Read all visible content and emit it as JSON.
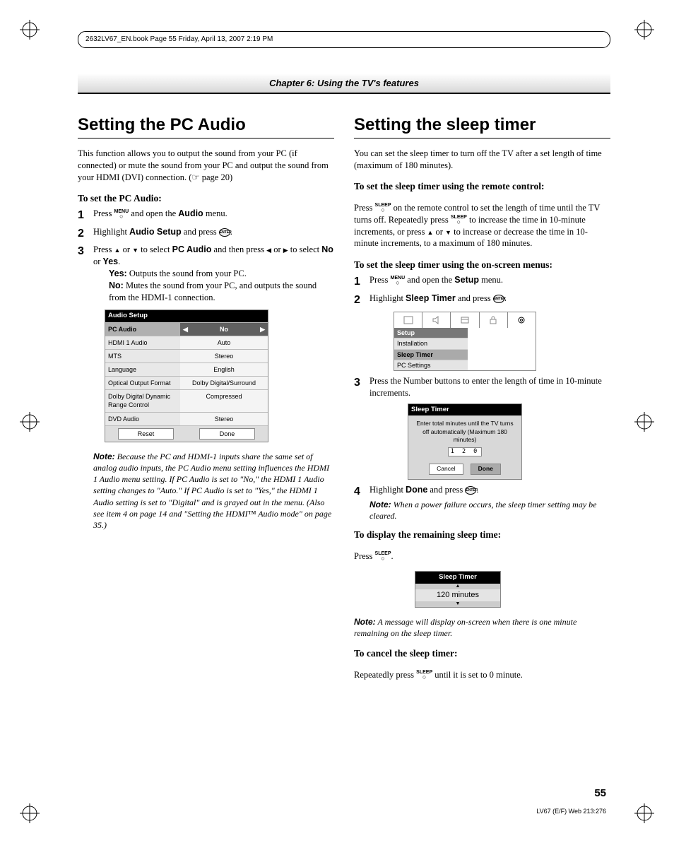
{
  "doc_info": "2632LV67_EN.book  Page 55  Friday, April 13, 2007  2:19 PM",
  "chapter_header": "Chapter 6: Using the TV's features",
  "page_number": "55",
  "footer_code": "LV67 (E/F) Web 213:276",
  "left": {
    "title": "Setting the PC Audio",
    "intro": "This function allows you to output the sound from your PC (if connected) or mute the sound from your PC and output the sound from your HDMI (DVI) connection. (☞ page 20)",
    "subhead": "To set the PC Audio:",
    "steps": {
      "s1_a": "Press ",
      "s1_b": " and open the ",
      "s1_menu": "Audio",
      "s1_c": " menu.",
      "s2_a": "Highlight ",
      "s2_b": "Audio Setup",
      "s2_c": " and press ",
      "s3_a": "Press ",
      "s3_b": " or ",
      "s3_c": " to select ",
      "s3_d": "PC Audio",
      "s3_e": " and then press ",
      "s3_f": " or ",
      "s3_g": " to select ",
      "s3_no": "No",
      "s3_or": " or ",
      "s3_yes": "Yes",
      "s3_end": ".",
      "yes_label": "Yes:",
      "yes_text": " Outputs the sound from your PC.",
      "no_label": "No:",
      "no_text": " Mutes the sound from your PC, and outputs the sound from the HDMI-1 connection."
    },
    "osd": {
      "title": "Audio Setup",
      "rows": [
        {
          "label": "PC Audio",
          "value": "No",
          "hl": true
        },
        {
          "label": "HDMI 1 Audio",
          "value": "Auto"
        },
        {
          "label": "MTS",
          "value": "Stereo"
        },
        {
          "label": "Language",
          "value": "English"
        },
        {
          "label": "Optical Output Format",
          "value": "Dolby Digital/Surround"
        },
        {
          "label": "Dolby Digital Dynamic Range Control",
          "value": "Compressed"
        },
        {
          "label": "DVD Audio",
          "value": "Stereo"
        }
      ],
      "reset": "Reset",
      "done": "Done"
    },
    "note_label": "Note:",
    "note_body": " Because the PC and HDMI-1 inputs share the same set of analog audio inputs, the PC Audio menu setting influences the HDMI 1 Audio menu setting. If PC Audio is set to \"No,\" the HDMI 1 Audio setting changes to \"Auto.\" If PC Audio is set to \"Yes,\" the HDMI 1 Audio setting is set to \"Digital\" and is grayed out in the menu. (Also see item 4 on page 14 and \"Setting the HDMI™ Audio mode\" on page 35.)"
  },
  "right": {
    "title": "Setting the sleep timer",
    "intro": "You can set the sleep timer to turn off the TV after a set length of time (maximum of 180 minutes).",
    "subhead1": "To set the sleep timer using the remote control:",
    "para1_a": "Press ",
    "para1_b": " on the remote control to set the length of time until the TV turns off. Repeatedly press ",
    "para1_c": " to increase the time in 10-minute increments, or press ",
    "para1_d": " or ",
    "para1_e": " to increase or decrease the time in 10-minute increments, to a maximum of 180 minutes.",
    "subhead2": "To set the sleep timer using the on-screen menus:",
    "steps": {
      "s1_a": "Press ",
      "s1_b": " and open the ",
      "s1_menu": "Setup",
      "s1_c": " menu.",
      "s2_a": "Highlight ",
      "s2_b": "Sleep Timer",
      "s2_c": " and press ",
      "s3": "Press the Number buttons to enter the length of time in 10-minute increments.",
      "s4_a": "Highlight ",
      "s4_b": "Done",
      "s4_c": " and press "
    },
    "setup_osd": {
      "header": "Setup",
      "items": [
        "Installation",
        "Sleep Timer",
        "PC Settings"
      ],
      "selected_index": 1
    },
    "sleep_osd": {
      "title": "Sleep Timer",
      "msg": "Enter total minutes until the TV turns off automatically (Maximum 180 minutes)",
      "value": "1 2 0",
      "cancel": "Cancel",
      "done": "Done"
    },
    "note_label": "Note:",
    "note_body": " When a power failure occurs, the sleep timer setting may be cleared.",
    "subhead3": "To display the remaining sleep time:",
    "para3_a": "Press ",
    "para3_b": ".",
    "sleep_disp": {
      "title": "Sleep Timer",
      "value": "120 minutes"
    },
    "note2_label": "Note:",
    "note2_body": " A message will display on-screen when there is one minute remaining on the sleep timer.",
    "subhead4": "To cancel the sleep timer:",
    "para4_a": "Repeatedly press ",
    "para4_b": " until it is set to 0 minute."
  },
  "remote": {
    "menu": "MENU",
    "sleep": "SLEEP",
    "enter": "ENTER"
  },
  "arrows": {
    "up": "▲",
    "down": "▼",
    "left": "◀",
    "right": "▶"
  }
}
